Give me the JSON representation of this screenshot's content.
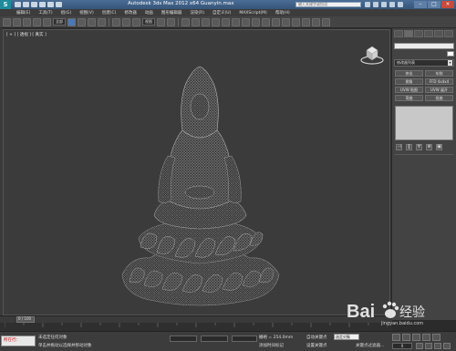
{
  "window": {
    "title": "Autodesk 3ds Max  2012 x64      Guanyin.max",
    "search_placeholder": "输入关键字或短语",
    "logo_letter": "S",
    "controls": [
      "–",
      "□",
      "×"
    ]
  },
  "menu": [
    "编辑(E)",
    "工具(T)",
    "组(G)",
    "视图(V)",
    "创建(C)",
    "修改器",
    "动画",
    "图形编辑器",
    "渲染(R)",
    "自定义(U)",
    "MAXScript(M)",
    "帮助(H)"
  ],
  "toolbar": {
    "filter_dropdown": "全部",
    "refcoord_dropdown": "视图"
  },
  "viewport": {
    "label": "[ + ] [ 透视 ] [ 真实 ]",
    "background_color": "#3b3b3b"
  },
  "command_panel": {
    "modifier_list": "修改器列表",
    "buttons": [
      "挤出",
      "车削",
      "倒角",
      "FFD 4x4x4",
      "UVW 贴图",
      "UVW 展开",
      "弯曲",
      "扭曲"
    ],
    "stack_tools": [
      "⊣",
      "‖",
      "∀",
      "⊗",
      "▣"
    ]
  },
  "timeline": {
    "frame_label": "0 / 100"
  },
  "statusbar": {
    "mode_label": "所在行：",
    "msg1": "未选定任何对象",
    "msg2": "单击并拖动以选择并移动对象",
    "grid": "栅格 = 254.0mm",
    "add_time_tag": "添加时间标记",
    "auto_key": "自动关键点",
    "set_key": "设置关键点",
    "selection_dropdown": "选定对象",
    "key_filter": "关键点过滤器...",
    "frame_value": "0"
  },
  "watermark": {
    "text": "Bai",
    "text2": "经验",
    "sub": "jingyan.baidu.com"
  }
}
